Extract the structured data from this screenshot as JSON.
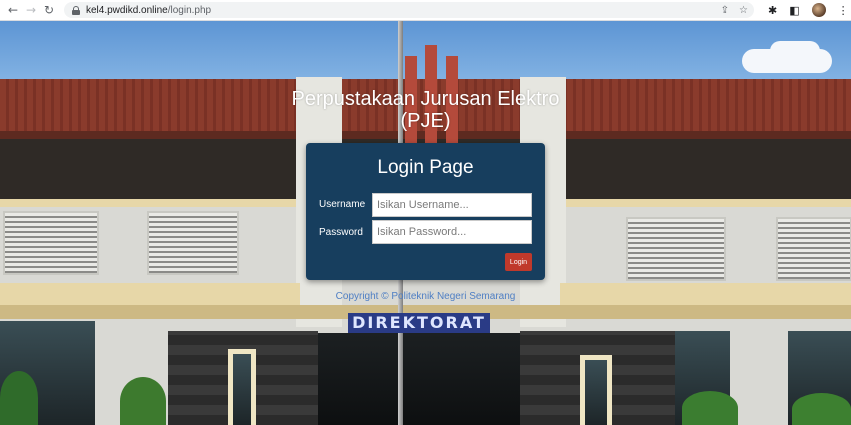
{
  "browser": {
    "url_host": "kel4.pwdikd.online",
    "url_path": "/login.php",
    "icons": [
      "back-arrow-icon",
      "forward-arrow-icon",
      "reload-icon",
      "lock-icon",
      "share-icon",
      "bookmark-star-icon",
      "extensions-icon",
      "side-panel-icon",
      "profile-avatar",
      "menu-kebab-icon"
    ]
  },
  "page": {
    "title_line1": "Perpustakaan Jurusan Elektro",
    "title_line2": "(PJE)",
    "signboard": "DIREKTORAT",
    "copyright": "Copyright © Politeknik Negeri Semarang"
  },
  "login": {
    "heading": "Login Page",
    "username_label": "Username",
    "username_placeholder": "Isikan Username...",
    "username_value": "",
    "password_label": "Password",
    "password_placeholder": "Isikan Password...",
    "password_value": "",
    "submit_label": "Login"
  },
  "colors": {
    "card_bg": "#173e5e",
    "button_bg": "#c0392b",
    "copyright_text": "#4f7fc4"
  }
}
